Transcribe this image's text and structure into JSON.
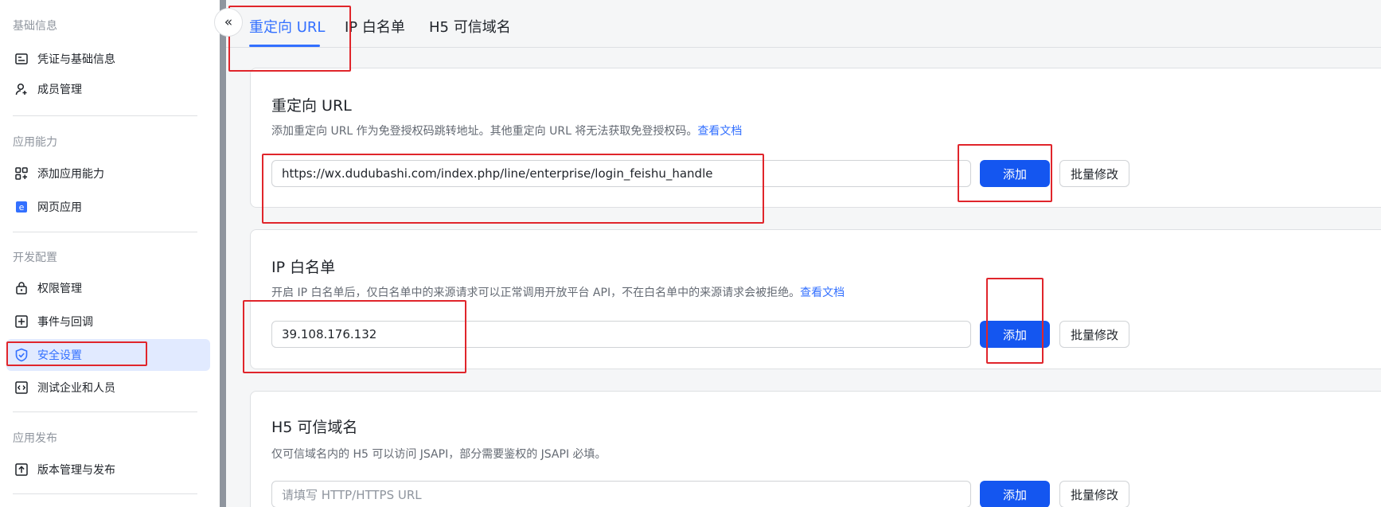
{
  "sidebar": {
    "sections": [
      {
        "title": "基础信息",
        "items": [
          {
            "label": "凭证与基础信息",
            "icon": "credential-card-icon"
          },
          {
            "label": "成员管理",
            "icon": "member-add-icon"
          }
        ]
      },
      {
        "title": "应用能力",
        "items": [
          {
            "label": "添加应用能力",
            "icon": "add-capability-icon"
          },
          {
            "label": "网页应用",
            "icon": "web-app-icon"
          }
        ]
      },
      {
        "title": "开发配置",
        "items": [
          {
            "label": "权限管理",
            "icon": "permission-lock-icon"
          },
          {
            "label": "事件与回调",
            "icon": "event-callback-icon"
          },
          {
            "label": "安全设置",
            "icon": "shield-icon",
            "active": true
          },
          {
            "label": "测试企业和人员",
            "icon": "code-test-icon"
          }
        ]
      },
      {
        "title": "应用发布",
        "items": [
          {
            "label": "版本管理与发布",
            "icon": "upload-release-icon"
          }
        ]
      }
    ],
    "collapse_glyph": "«"
  },
  "tabs": [
    {
      "label": "重定向 URL",
      "active": true
    },
    {
      "label": "IP 白名单"
    },
    {
      "label": "H5 可信域名"
    }
  ],
  "cards": {
    "redirect": {
      "title": "重定向 URL",
      "desc": "添加重定向 URL 作为免登授权码跳转地址。其他重定向 URL 将无法获取免登授权码。",
      "doc_link": "查看文档",
      "input_value": "https://wx.dudubashi.com/index.php/line/enterprise/login_feishu_handle",
      "add_label": "添加",
      "batch_label": "批量修改"
    },
    "ip_whitelist": {
      "title": "IP 白名单",
      "desc": "开启 IP 白名单后，仅白名单中的来源请求可以正常调用开放平台 API，不在白名单中的来源请求会被拒绝。",
      "doc_link": "查看文档",
      "input_value": "39.108.176.132",
      "add_label": "添加",
      "batch_label": "批量修改"
    },
    "h5_domain": {
      "title": "H5 可信域名",
      "desc": "仅可信域名内的 H5 可以访问 JSAPI，部分需要鉴权的 JSAPI 必填。",
      "input_placeholder": "请填写 HTTP/HTTPS URL",
      "add_label": "添加",
      "batch_label": "批量修改"
    }
  },
  "colors": {
    "accent": "#3370ff",
    "primary_button": "#1456f0",
    "annotation": "#e0252b",
    "active_bg": "#e1eaff"
  }
}
